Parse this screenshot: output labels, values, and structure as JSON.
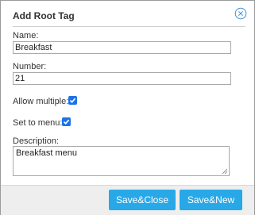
{
  "dialog": {
    "title": "Add Root Tag",
    "close_icon": "close-circle-icon"
  },
  "fields": {
    "name": {
      "label": "Name:",
      "value": "Breakfast"
    },
    "number": {
      "label": "Number:",
      "value": "21"
    },
    "allow_multiple": {
      "label": "Allow multiple:",
      "checked": true
    },
    "set_to_menu": {
      "label": "Set to menu:",
      "checked": true
    },
    "description": {
      "label": "Description:",
      "value": "Breakfast menu"
    }
  },
  "buttons": {
    "save_close": "Save&Close",
    "save_new": "Save&New"
  },
  "colors": {
    "button_bg": "#29a8e8",
    "checkbox": "#1a73e8",
    "footer_bg": "#eeeeee",
    "close_icon": "#3b8fd9"
  }
}
